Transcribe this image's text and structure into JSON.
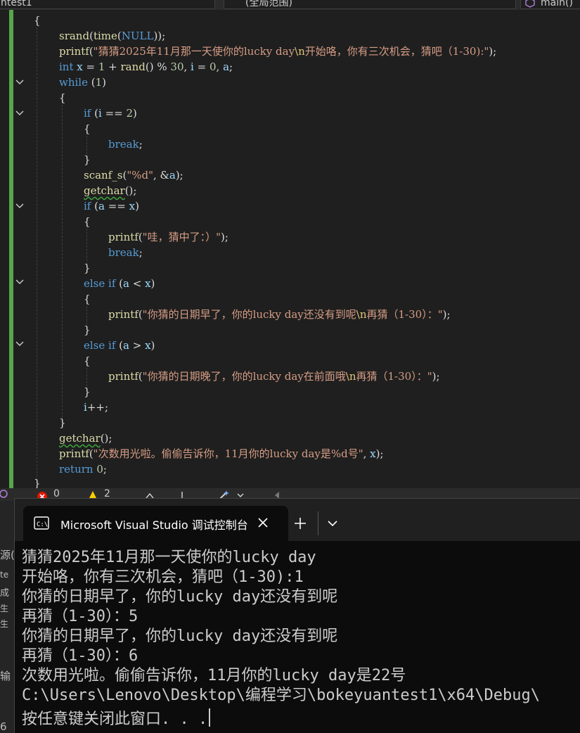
{
  "top_tabs": {
    "project": "ntest1",
    "scope": "(全局范围)",
    "member": "main()"
  },
  "code": {
    "lines": [
      "{",
      "    srand(time(NULL));",
      "    printf(\"猜猜2025年11月那一天使你的lucky day\\n开始咯，你有三次机会，猜吧（1-30):\");",
      "    int x = 1 + rand() % 30, i = 0, a;",
      "    while (1)",
      "    {",
      "        if (i == 2)",
      "        {",
      "            break;",
      "        }",
      "        scanf_s(\"%d\", &a);",
      "        getchar();",
      "        if (a == x)",
      "        {",
      "            printf(\"哇，猜中了：）\");",
      "            break;",
      "        }",
      "        else if (a < x)",
      "        {",
      "            printf(\"你猜的日期早了，你的lucky day还没有到呢\\n再猜（1-30）：\");",
      "        }",
      "        else if (a > x)",
      "        {",
      "            printf(\"你猜的日期晚了，你的lucky day在前面哦\\n再猜（1-30）：\");",
      "        }",
      "        i++;",
      "    }",
      "    getchar();",
      "    printf(\"次数用光啦。偷偷告诉你，11月你的lucky day是%d号\", x);",
      "    return 0;",
      "}"
    ]
  },
  "status_bar": {
    "errors": "0",
    "warnings": "2"
  },
  "side_panel": {
    "fragments": [
      "源(",
      "te",
      "成",
      "生",
      "生",
      "输"
    ],
    "line_number": "6"
  },
  "terminal": {
    "tab_title": "Microsoft Visual Studio 调试控制台",
    "output_lines": [
      "猜猜2025年11月那一天使你的lucky day",
      "开始咯，你有三次机会，猜吧（1-30):1",
      "你猜的日期早了，你的lucky day还没有到呢",
      "再猜（1-30）：5",
      "你猜的日期早了，你的lucky day还没有到呢",
      "再猜（1-30）：6",
      "次数用光啦。偷偷告诉你，11月你的lucky day是22号",
      "C:\\Users\\Lenovo\\Desktop\\编程学习\\bokeyuantest1\\x64\\Debug\\",
      "按任意键关闭此窗口. . ."
    ]
  },
  "icons": {
    "terminal_tab": "console-app-icon",
    "close": "close-icon",
    "new_tab": "plus-icon",
    "dropdown": "chevron-down-icon",
    "fold": "chevron-down-icon"
  },
  "colors": {
    "editor_bg": "#1f1f1f",
    "keyword": "#569cd6",
    "string": "#d69d85",
    "function": "#dcdcaa",
    "identifier": "#9cdcfe",
    "number": "#b5cea8",
    "change_bar": "#57a64a",
    "terminal_bg": "#0c0c0c",
    "terminal_text": "#cccccc"
  }
}
